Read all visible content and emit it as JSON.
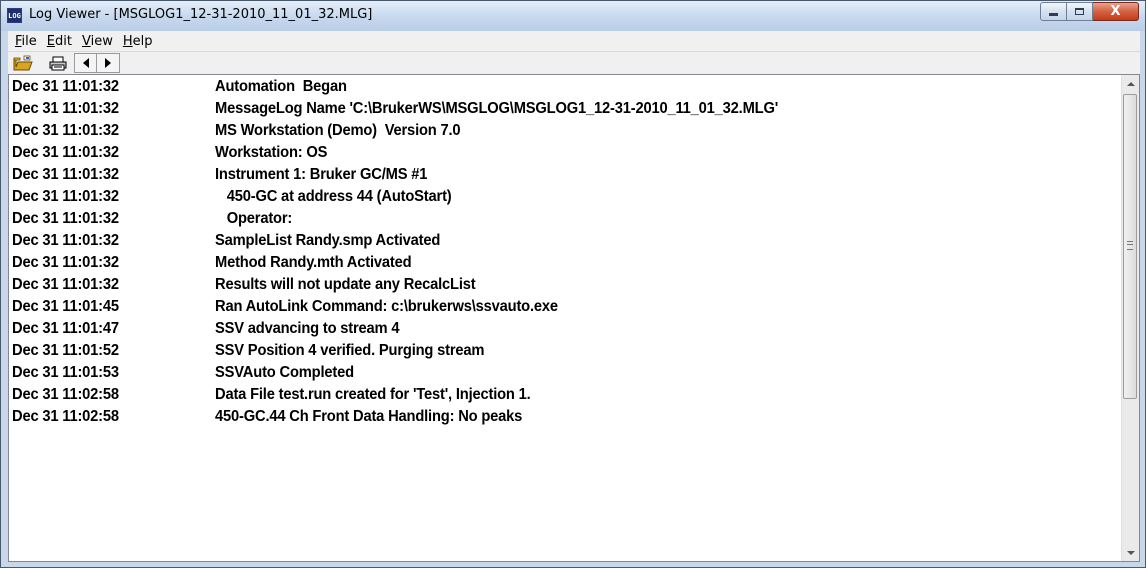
{
  "window": {
    "title": "Log Viewer - [MSGLOG1_12-31-2010_11_01_32.MLG]",
    "app_icon_text": "LOG",
    "close_glyph": "X"
  },
  "menu": [
    {
      "accel": "F",
      "rest": "ile"
    },
    {
      "accel": "E",
      "rest": "dit"
    },
    {
      "accel": "V",
      "rest": "iew"
    },
    {
      "accel": "H",
      "rest": "elp"
    }
  ],
  "toolbar": {
    "open_icon": "folder-open-icon",
    "print_icon": "printer-icon",
    "prev_icon": "arrow-left-icon",
    "next_icon": "arrow-right-icon"
  },
  "log": [
    {
      "time": "Dec 31 11:01:32",
      "message": "Automation  Began"
    },
    {
      "time": "Dec 31 11:01:32",
      "message": "MessageLog Name 'C:\\BrukerWS\\MSGLOG\\MSGLOG1_12-31-2010_11_01_32.MLG'"
    },
    {
      "time": "Dec 31 11:01:32",
      "message": "MS Workstation (Demo)  Version 7.0"
    },
    {
      "time": "Dec 31 11:01:32",
      "message": "Workstation: OS"
    },
    {
      "time": "Dec 31 11:01:32",
      "message": "Instrument 1: Bruker GC/MS #1"
    },
    {
      "time": "Dec 31 11:01:32",
      "message": "   450-GC at address 44 (AutoStart)"
    },
    {
      "time": "Dec 31 11:01:32",
      "message": "   Operator:"
    },
    {
      "time": "Dec 31 11:01:32",
      "message": "SampleList Randy.smp Activated"
    },
    {
      "time": "Dec 31 11:01:32",
      "message": "Method Randy.mth Activated"
    },
    {
      "time": "Dec 31 11:01:32",
      "message": "Results will not update any RecalcList"
    },
    {
      "time": "Dec 31 11:01:45",
      "message": "Ran AutoLink Command: c:\\brukerws\\ssvauto.exe"
    },
    {
      "time": "Dec 31 11:01:47",
      "message": "SSV advancing to stream 4"
    },
    {
      "time": "Dec 31 11:01:52",
      "message": "SSV Position 4 verified. Purging stream"
    },
    {
      "time": "Dec 31 11:01:53",
      "message": "SSVAuto Completed"
    },
    {
      "time": "Dec 31 11:02:58",
      "message": "Data File test.run created for 'Test', Injection 1."
    },
    {
      "time": "Dec 31 11:02:58",
      "message": "450-GC.44 Ch Front Data Handling: No peaks"
    }
  ],
  "colors": {
    "title_bar": "#c6d8ee",
    "close_button": "#c43c1c",
    "menu_bar": "#f0f0f0",
    "log_background": "#ffffff"
  }
}
